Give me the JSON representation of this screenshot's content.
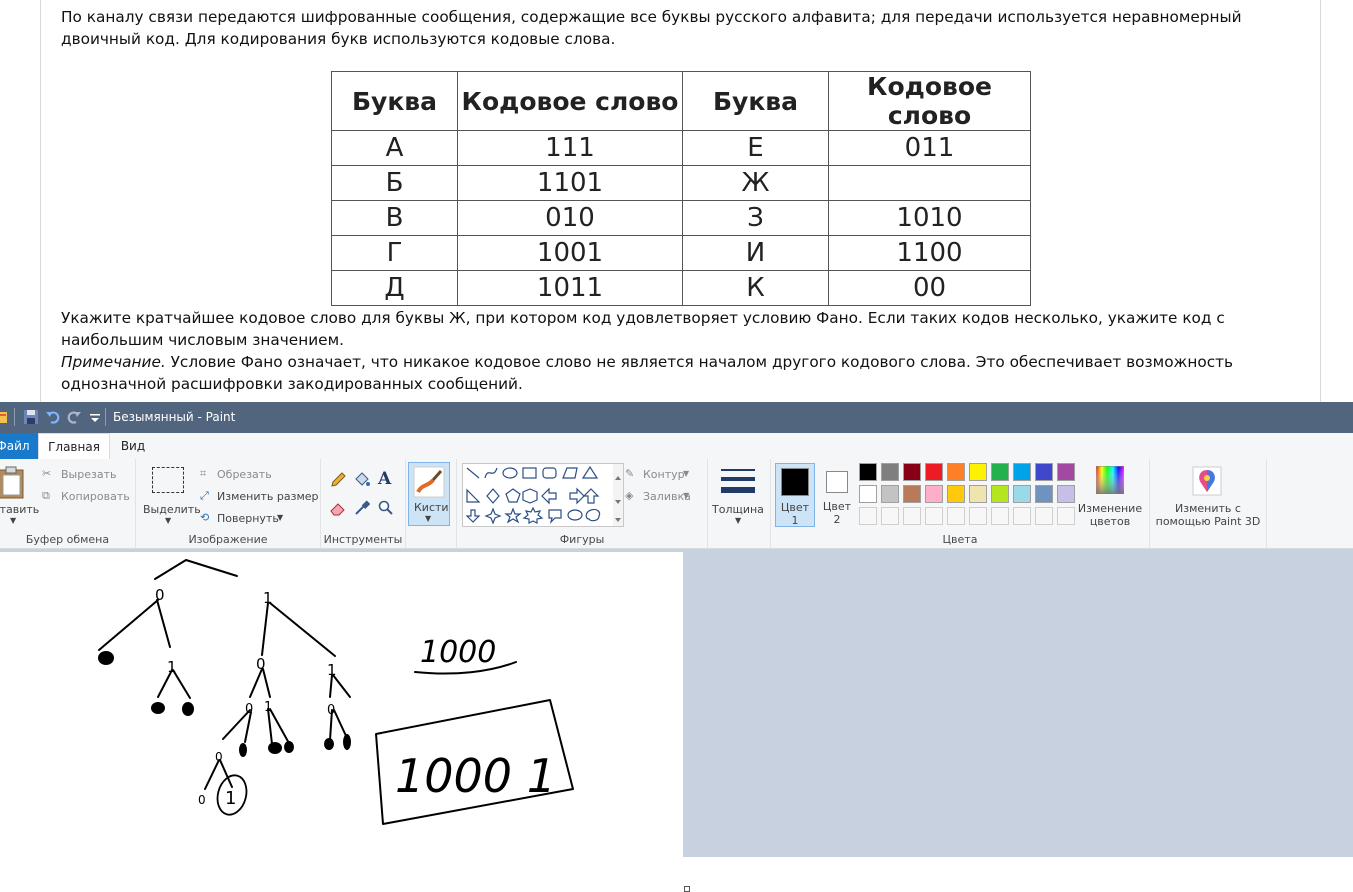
{
  "webpage": {
    "intro": "По каналу связи передаются шифрованные сообщения, содержащие все буквы русского алфавита; для передачи используется неравномерный двоичный код. Для кодирования букв используются кодовые слова.",
    "table": {
      "headers": [
        "Буква",
        "Кодовое слово",
        "Буква",
        "Кодовое слово"
      ],
      "rows": [
        [
          "А",
          "111",
          "Е",
          "011"
        ],
        [
          "Б",
          "1101",
          "Ж",
          ""
        ],
        [
          "В",
          "010",
          "З",
          "1010"
        ],
        [
          "Г",
          "1001",
          "И",
          "1100"
        ],
        [
          "Д",
          "1011",
          "К",
          "00"
        ]
      ]
    },
    "question": "Укажите кратчайшее кодовое слово для буквы Ж, при котором код удовлетворяет условию Фано. Если таких кодов несколько, укажите код с наибольшим числовым значением.",
    "note_label": "Примечание.",
    "note_text": " Условие Фано означает, что никакое кодовое слово не является началом другого кодового слова. Это обеспечивает возможность однозначной расшифровки закодированных сообщений."
  },
  "paint": {
    "title": "Безымянный - Paint",
    "tabs": {
      "file": "Файл",
      "home": "Главная",
      "view": "Вид"
    },
    "clipboard": {
      "paste": "Вставить",
      "cut": "Вырезать",
      "copy": "Копировать",
      "label": "Буфер обмена"
    },
    "image": {
      "select": "Выделить",
      "crop": "Обрезать",
      "resize": "Изменить размер",
      "rotate": "Повернуть",
      "label": "Изображение"
    },
    "tools": {
      "label": "Инструменты"
    },
    "brushes": {
      "label": "Кисти"
    },
    "shapes": {
      "outline": "Контур",
      "fill": "Заливка",
      "label": "Фигуры"
    },
    "size": {
      "label": "Толщина"
    },
    "colors": {
      "color1": "Цвет 1",
      "color2": "Цвет 2",
      "edit": "Изменение цветов",
      "label": "Цвета",
      "color1_value": "#000000",
      "color2_value": "#ffffff",
      "palette_row1": [
        "#000000",
        "#7f7f7f",
        "#880015",
        "#ed1c24",
        "#ff7f27",
        "#fff200",
        "#22b14c",
        "#00a2e8",
        "#3f48cc",
        "#a349a4"
      ],
      "palette_row2": [
        "#ffffff",
        "#c3c3c3",
        "#b97a57",
        "#ffaec9",
        "#ffc90e",
        "#efe4b0",
        "#b5e61d",
        "#99d9ea",
        "#7092be",
        "#c8bfe7"
      ]
    },
    "paint3d": "Изменить с помощью Paint 3D",
    "drawing": {
      "root_left": "0",
      "root_right": "1",
      "l2": [
        "1",
        "0",
        "1"
      ],
      "l3": [
        "0",
        "1",
        "0"
      ],
      "l4": "0",
      "l5": [
        "0",
        "1"
      ],
      "note_value": "1000",
      "answer": "1000 1"
    }
  }
}
